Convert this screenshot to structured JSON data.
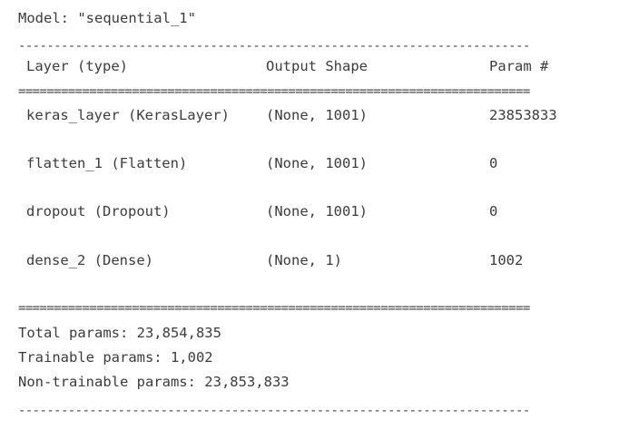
{
  "model_title": "Model: \"sequential_1\"",
  "header": {
    "layer": "Layer (type)",
    "output_shape": "Output Shape",
    "param": "Param #"
  },
  "rows": [
    {
      "layer": "keras_layer (KerasLayer)",
      "output_shape": "(None, 1001)",
      "param": "23853833"
    },
    {
      "layer": "flatten_1 (Flatten)",
      "output_shape": "(None, 1001)",
      "param": "0"
    },
    {
      "layer": "dropout (Dropout)",
      "output_shape": "(None, 1001)",
      "param": "0"
    },
    {
      "layer": "dense_2 (Dense)",
      "output_shape": "(None, 1)",
      "param": "1002"
    }
  ],
  "totals": {
    "total": "Total params: 23,854,835",
    "trainable": "Trainable params: 1,002",
    "non_trainable": "Non-trainable params: 23,853,833"
  },
  "rules": {
    "dash": "------------------------------------------------------------------------",
    "equals": "========================================================================"
  }
}
